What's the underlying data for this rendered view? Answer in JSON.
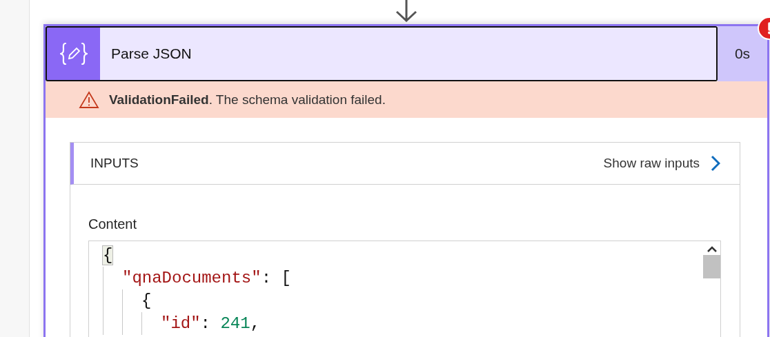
{
  "action": {
    "title": "Parse JSON",
    "duration": "0s",
    "has_error": true
  },
  "error_banner": {
    "message": "**ValidationFailed**. The schema validation failed."
  },
  "inputs": {
    "heading": "INPUTS",
    "raw_link": "Show raw inputs",
    "field_label": "Content",
    "code": [
      {
        "tokens": [
          {
            "text": "{",
            "kind": "punct",
            "highlighted": true
          }
        ],
        "children": [
          {
            "tokens": [
              {
                "text": "\"qnaDocuments\"",
                "kind": "key",
                "highlighted": false
              },
              {
                "text": ": [",
                "kind": "punct",
                "highlighted": false
              }
            ],
            "children": [
              {
                "tokens": [
                  {
                    "text": "{",
                    "kind": "punct",
                    "highlighted": false
                  }
                ],
                "children": [
                  {
                    "tokens": [
                      {
                        "text": "\"id\"",
                        "kind": "key",
                        "highlighted": false
                      },
                      {
                        "text": ": ",
                        "kind": "punct",
                        "highlighted": false
                      },
                      {
                        "text": "241",
                        "kind": "number",
                        "highlighted": false
                      },
                      {
                        "text": ",",
                        "kind": "punct",
                        "highlighted": false
                      }
                    ]
                  }
                ]
              }
            ]
          }
        ]
      }
    ]
  }
}
